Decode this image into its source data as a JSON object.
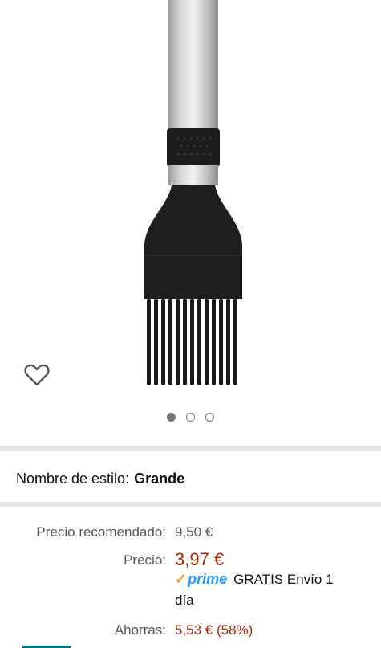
{
  "gallery": {
    "image_subject": "pastry brush with silicone bristles",
    "dots": [
      {
        "active": true
      },
      {
        "active": false
      },
      {
        "active": false
      }
    ],
    "icons": {
      "wishlist": "heart-outline-icon"
    }
  },
  "style": {
    "label": "Nombre de estilo:",
    "value": "Grande"
  },
  "pricing": {
    "recommended_label": "Precio recomendado:",
    "recommended_value": "9,50 €",
    "price_label": "Precio:",
    "price_value": "3,97 €",
    "prime_check": "✓",
    "prime_text": "prime",
    "shipping_line1": "GRATIS Envío 1",
    "shipping_line2": "día",
    "savings_label": "Ahorras:",
    "savings_value": "5,53 € (58%)"
  },
  "colors": {
    "price_red": "#b12704",
    "prime_blue": "#1a98ff",
    "prime_check_orange": "#f0a020",
    "divider_gray": "#e3e6e6"
  }
}
